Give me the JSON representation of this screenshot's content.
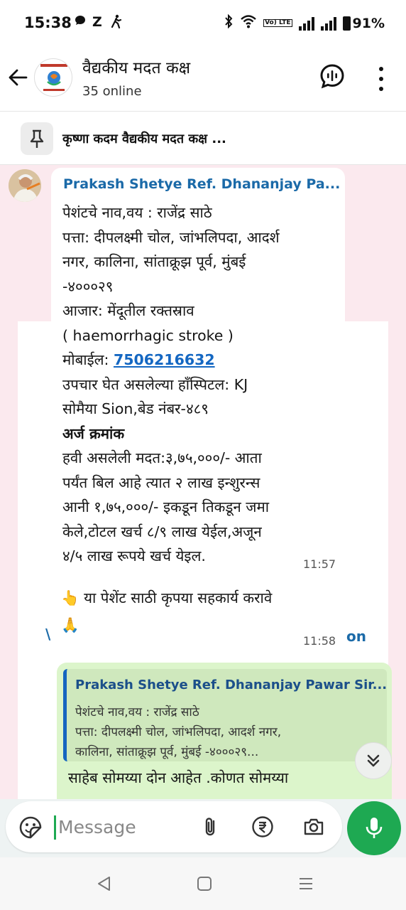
{
  "status_bar": {
    "time": "15:38",
    "battery": "91%",
    "network_label": "Vo) LTE",
    "icons": [
      "chat-notification-icon",
      "z-icon",
      "walking-icon",
      "bluetooth-icon",
      "wifi-icon",
      "volte-icon",
      "signal-icon",
      "signal-icon",
      "battery-icon"
    ]
  },
  "header": {
    "group_name": "वैद्यकीय मदत कक्ष",
    "status": "35 online"
  },
  "pinned": {
    "text": "कृष्णा कदम वैद्यकीय मदत कक्ष ..."
  },
  "messages": {
    "first": {
      "sender": "Prakash Shetye Ref. Dhananjay Pa...",
      "lines": [
        "पेशंटचे नाव,वय : राजेंद्र साठे",
        "पत्ता: दीपलक्ष्मी चोल, जांभलिपदा, आदर्श",
        "नगर, कालिना, सांताक्रूझ पूर्व, मुंबई",
        "-४०००२९",
        "आजार: मेंदूतील रक्तस्राव",
        "( haemorrhagic stroke )"
      ],
      "mobile_label": "मोबाईल: ",
      "phone": "7506216632",
      "lines2": [
        "उपचार घेत असलेल्या हाँस्पिटल: KJ",
        "सोमैया Sion,बेड नंबर-४८९"
      ],
      "application_heading": "अर्ज क्रमांक",
      "lines3": [
        "हवी असलेली मदत:३,७५,०००/- आता",
        "पर्यंत बिल आहे त्यात २ लाख इन्शुरन्स",
        "आनी १,७५,०००/- इकडून तिकडून जमा",
        "केले,टोटल खर्च ८/९ लाख येईल,अजून",
        "४/५ लाख रूपये खर्च येइल."
      ],
      "time": "11:57"
    },
    "second": {
      "pointer_emoji": "👆",
      "text": "या पेशेंट साठी कृपया सहकार्य करावे",
      "pray_emoji": "🙏",
      "time": "11:58"
    },
    "reply": {
      "quoted_sender": "Prakash Shetye Ref. Dhananjay Pawar Sir...",
      "quoted_line1": "पेशंटचे नाव,वय : राजेंद्र साठे",
      "quoted_line2": "पत्ता: दीपलक्ष्मी चोल, जांभलिपदा, आदर्श नगर,",
      "quoted_line3": "कालिना, सांताक्रूझ पूर्व, मुंबई -४०००२९...",
      "text": "साहेब सोमय्या दोन आहेत .कोणत सोमय्या"
    },
    "background_fragments": {
      "left": "\\",
      "right": "on"
    }
  },
  "composer": {
    "placeholder": "Message"
  },
  "colors": {
    "accent_green": "#1ea952",
    "chat_background": "#fbe9ee",
    "outgoing_bubble": "#dcf5cb",
    "sender_name": "#1b6aa8",
    "link": "#1467c2"
  }
}
